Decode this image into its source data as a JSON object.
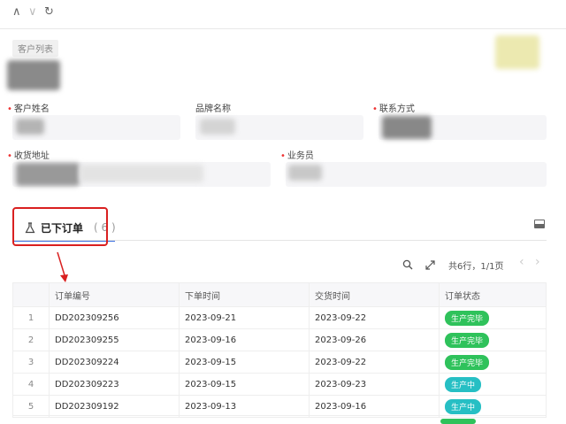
{
  "header": {
    "back_glyph": "∧",
    "forward_glyph": "∨",
    "refresh_glyph": "↻"
  },
  "breadcrumb": "客户列表",
  "form": {
    "customer_name_label": "客户姓名",
    "brand_name_label": "品牌名称",
    "contact_label": "联系方式",
    "address_label": "收货地址",
    "salesperson_label": "业务员"
  },
  "tab": {
    "label": "已下订单",
    "count": "( 6 )"
  },
  "toolbar": {
    "summary": "共6行，1/1页",
    "prev": "‹",
    "next": "›"
  },
  "table": {
    "headers": [
      "订单编号",
      "下单时间",
      "交货时间",
      "订单状态"
    ],
    "rows": [
      {
        "index": "1",
        "order_no": "DD202309256",
        "order_date": "2023-09-21",
        "delivery_date": "2023-09-22",
        "status": "生产完毕",
        "status_color": "#2fc25b"
      },
      {
        "index": "2",
        "order_no": "DD202309255",
        "order_date": "2023-09-16",
        "delivery_date": "2023-09-26",
        "status": "生产完毕",
        "status_color": "#2fc25b"
      },
      {
        "index": "3",
        "order_no": "DD202309224",
        "order_date": "2023-09-15",
        "delivery_date": "2023-09-22",
        "status": "生产完毕",
        "status_color": "#2fc25b"
      },
      {
        "index": "4",
        "order_no": "DD202309223",
        "order_date": "2023-09-15",
        "delivery_date": "2023-09-23",
        "status": "生产中",
        "status_color": "#26bfc4"
      },
      {
        "index": "5",
        "order_no": "DD202309192",
        "order_date": "2023-09-13",
        "delivery_date": "2023-09-16",
        "status": "生产中",
        "status_color": "#26bfc4"
      }
    ]
  },
  "colors": {
    "accent": "#3b6fe0",
    "highlight": "#d92020",
    "done": "#2fc25b",
    "in_progress": "#26bfc4"
  }
}
